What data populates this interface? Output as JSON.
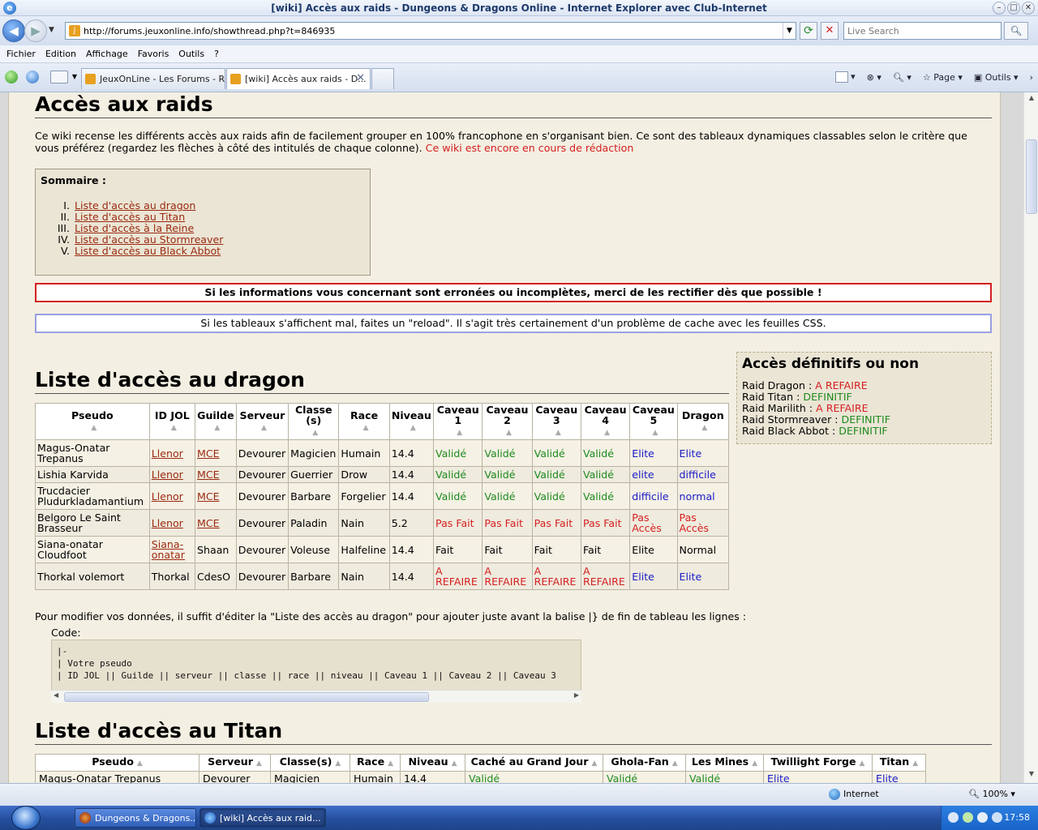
{
  "window": {
    "title": "[wiki] Accès aux raids - Dungeons & Dragons Online - Internet Explorer avec Club-Internet"
  },
  "address": {
    "url": "http://forums.jeuxonline.info/showthread.php?t=846935",
    "search_placeholder": "Live Search"
  },
  "menu": [
    "Fichier",
    "Edition",
    "Affichage",
    "Favoris",
    "Outils",
    "?"
  ],
  "tabs": [
    {
      "label": "JeuxOnLine - Les Forums - R..."
    },
    {
      "label": "[wiki] Accès aux raids - D..."
    }
  ],
  "command_bar": {
    "page": "Page",
    "tools": "Outils"
  },
  "content": {
    "title": "Accès aux raids",
    "intro": "Ce wiki recense les différents accès aux raids afin de facilement grouper en 100% francophone en s'organisant bien. Ce sont des tableaux dynamiques classables selon le critère que vous préférez (regardez les flèches à côté des intitulés de chaque colonne). ",
    "intro_red": "Ce wiki est encore en cours de rédaction",
    "toc": {
      "title": "Sommaire :",
      "items": [
        "Liste d'accès au dragon",
        "Liste d'accès au Titan",
        "Liste d'accès à la Reine",
        "Liste d'accès au Stormreaver",
        "Liste d'accès au Black Abbot"
      ]
    },
    "warning_red": "Si les informations vous concernant sont erronées ou incomplètes, merci de les rectifier dès que possible !",
    "warning_blue": "Si les tableaux s'affichent mal, faites un \"reload\". Il s'agit très certainement d'un problème de cache avec les feuilles CSS.",
    "side": {
      "title": "Accès définitifs ou non",
      "rows": [
        {
          "label": "Raid Dragon : ",
          "value": "A REFAIRE",
          "color": "red"
        },
        {
          "label": "Raid Titan : ",
          "value": "DEFINITIF",
          "color": "green"
        },
        {
          "label": "Raid Marilith : ",
          "value": "A REFAIRE",
          "color": "red"
        },
        {
          "label": "Raid Stormreaver : ",
          "value": "DEFINITIF",
          "color": "green"
        },
        {
          "label": "Raid Black Abbot : ",
          "value": "DEFINITIF",
          "color": "green"
        }
      ]
    },
    "dragon_title": "Liste d'accès au dragon",
    "dragon_headers": [
      "Pseudo",
      "ID JOL",
      "Guilde",
      "Serveur",
      "Classe (s)",
      "Race",
      "Niveau",
      "Caveau 1",
      "Caveau 2",
      "Caveau 3",
      "Caveau 4",
      "Caveau 5",
      "Dragon"
    ],
    "dragon_rows": [
      {
        "cells": [
          "Magus-Onatar Trepanus",
          "Llenor",
          "MCE",
          "Devourer",
          "Magicien",
          "Humain",
          "14.4",
          "Validé",
          "Validé",
          "Validé",
          "Validé",
          "Elite",
          "Elite"
        ],
        "colors": [
          "",
          "link",
          "link",
          "",
          "",
          "",
          "",
          "green",
          "green",
          "green",
          "green",
          "blue",
          "blue"
        ]
      },
      {
        "cells": [
          "Lishia Karvida",
          "Llenor",
          "MCE",
          "Devourer",
          "Guerrier",
          "Drow",
          "14.4",
          "Validé",
          "Validé",
          "Validé",
          "Validé",
          "elite",
          "difficile"
        ],
        "colors": [
          "",
          "link",
          "link",
          "",
          "",
          "",
          "",
          "green",
          "green",
          "green",
          "green",
          "blue",
          "blue"
        ]
      },
      {
        "cells": [
          "Trucdacier Pludurkladamantium",
          "Llenor",
          "MCE",
          "Devourer",
          "Barbare",
          "Forgelier",
          "14.4",
          "Validé",
          "Validé",
          "Validé",
          "Validé",
          "difficile",
          "normal"
        ],
        "colors": [
          "",
          "link",
          "link",
          "",
          "",
          "",
          "",
          "green",
          "green",
          "green",
          "green",
          "blue",
          "blue"
        ]
      },
      {
        "cells": [
          "Belgoro Le Saint Brasseur",
          "Llenor",
          "MCE",
          "Devourer",
          "Paladin",
          "Nain",
          "5.2",
          "Pas Fait",
          "Pas Fait",
          "Pas Fait",
          "Pas Fait",
          "Pas Accès",
          "Pas Accès"
        ],
        "colors": [
          "",
          "link",
          "link",
          "",
          "",
          "",
          "",
          "red",
          "red",
          "red",
          "red",
          "red",
          "red"
        ]
      },
      {
        "cells": [
          "Siana-onatar Cloudfoot",
          "Siana-onatar",
          "Shaan",
          "Devourer",
          "Voleuse",
          "Halfeline",
          "14.4",
          "Fait",
          "Fait",
          "Fait",
          "Fait",
          "Elite",
          "Normal"
        ],
        "colors": [
          "",
          "link",
          "",
          "",
          "",
          "",
          "",
          "",
          "",
          "",
          "",
          "",
          ""
        ]
      },
      {
        "cells": [
          "Thorkal volemort",
          "Thorkal",
          "CdesO",
          "Devourer",
          "Barbare",
          "Nain",
          "14.4",
          "A REFAIRE",
          "A REFAIRE",
          "A REFAIRE",
          "A REFAIRE",
          "Elite",
          "Elite"
        ],
        "colors": [
          "",
          "",
          "",
          "",
          "",
          "",
          "",
          "red",
          "red",
          "red",
          "red",
          "blue",
          "blue"
        ]
      }
    ],
    "modify_text": "Pour modifier vos données, il suffit d'éditer la \"Liste des accès au dragon\" pour ajouter juste avant la balise |} de fin de tableau les lignes :",
    "code_label": "Code:",
    "code_lines": [
      "|-",
      "| Votre pseudo",
      "| ID JOL || Guilde || serveur || classe || race || niveau || Caveau 1 || Caveau 2 || Caveau 3"
    ],
    "titan_title": "Liste d'accès au Titan",
    "titan_headers": [
      "Pseudo",
      "Serveur",
      "Classe(s)",
      "Race",
      "Niveau",
      "Caché au Grand Jour",
      "Ghola-Fan",
      "Les Mines",
      "Twillight Forge",
      "Titan"
    ],
    "titan_row": {
      "cells": [
        "Magus-Onatar Trepanus",
        "Devourer",
        "Magicien",
        "Humain",
        "14.4",
        "Validé",
        "Validé",
        "Validé",
        "Elite",
        "Elite"
      ],
      "colors": [
        "",
        "",
        "",
        "",
        "",
        "green",
        "green",
        "green",
        "blue",
        "blue"
      ]
    }
  },
  "status": {
    "zone": "Internet",
    "zoom": "100%"
  },
  "taskbar": {
    "items": [
      "Dungeons & Dragons...",
      "[wiki] Accès aux raid..."
    ],
    "clock": "17:58"
  }
}
